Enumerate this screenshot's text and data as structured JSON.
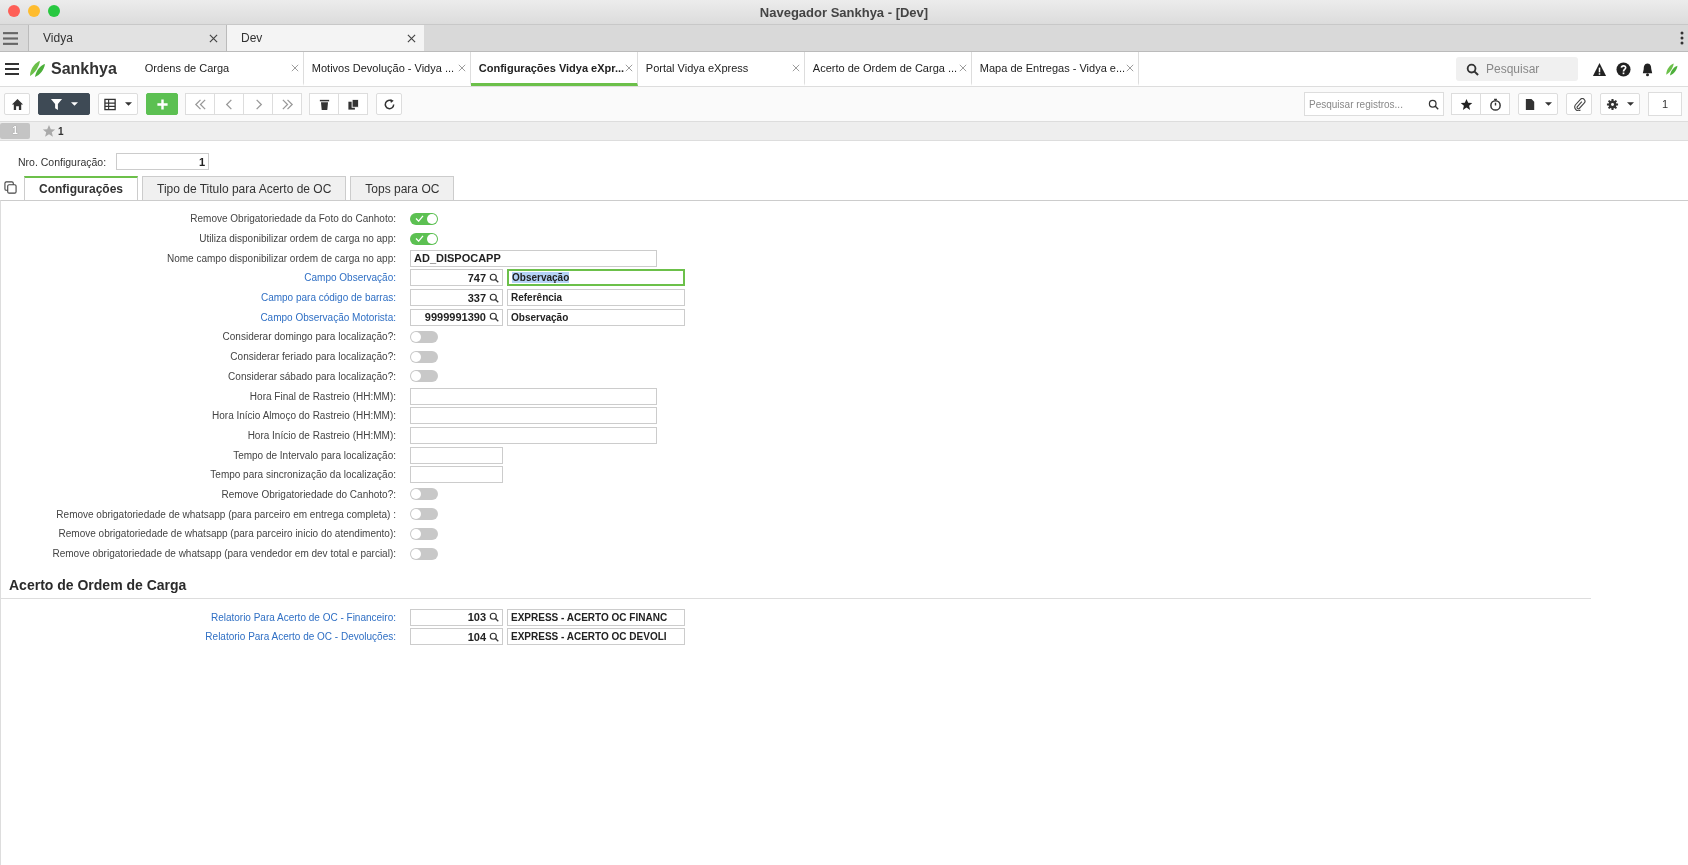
{
  "window": {
    "title": "Navegador Sankhya - [Dev]"
  },
  "browser_tabs": [
    {
      "label": "Vidya",
      "selected": false
    },
    {
      "label": "Dev",
      "selected": true
    }
  ],
  "app": {
    "brand": "Sankhya",
    "search_placeholder": "Pesquisar"
  },
  "app_tabs": [
    {
      "label": "Ordens de Carga",
      "selected": false
    },
    {
      "label": "Motivos Devolução - Vidya ...",
      "selected": false
    },
    {
      "label": "Configurações Vidya eXpr...",
      "selected": true
    },
    {
      "label": "Portal Vidya eXpress",
      "selected": false
    },
    {
      "label": "Acerto de Ordem de Carga ...",
      "selected": false
    },
    {
      "label": "Mapa de Entregas - Vidya e...",
      "selected": false
    }
  ],
  "toolbar": {
    "search_placeholder": "Pesquisar registros...",
    "page": "1"
  },
  "record_bar": {
    "record": "1",
    "favorites": "1"
  },
  "config": {
    "label": "Nro. Configuração:",
    "value": "1"
  },
  "form_tabs": [
    {
      "label": "Configurações",
      "selected": true
    },
    {
      "label": "Tipo de Titulo para Acerto de OC",
      "selected": false
    },
    {
      "label": "Tops para OC",
      "selected": false
    }
  ],
  "fields": [
    {
      "kind": "toggle",
      "label": "Remove Obrigatoriedade da Foto do Canhoto:",
      "on": true
    },
    {
      "kind": "toggle",
      "label": "Utiliza disponibilizar ordem de carga no app:",
      "on": true
    },
    {
      "kind": "text",
      "label": "Nome campo disponibilizar ordem de carga no app:",
      "value": "AD_DISPOCAPP"
    },
    {
      "kind": "lookup",
      "label": "Campo Observação:",
      "code": "747",
      "description": "Observação",
      "focused": true
    },
    {
      "kind": "lookup",
      "label": "Campo para código de barras:",
      "code": "337",
      "description": "Referência",
      "focused": false
    },
    {
      "kind": "lookup",
      "label": "Campo Observação Motorista:",
      "code": "9999991390",
      "description": "Observação",
      "focused": false
    },
    {
      "kind": "toggle",
      "label": "Considerar domingo para localização?:",
      "on": false
    },
    {
      "kind": "toggle",
      "label": "Considerar feriado para localização?:",
      "on": false
    },
    {
      "kind": "toggle",
      "label": "Considerar sábado para localização?:",
      "on": false
    },
    {
      "kind": "text",
      "label": "Hora Final de Rastreio (HH:MM):"
    },
    {
      "kind": "text",
      "label": "Hora Início Almoço do Rastreio (HH:MM):"
    },
    {
      "kind": "text",
      "label": "Hora Início de Rastreio (HH:MM):"
    },
    {
      "kind": "number",
      "label": "Tempo de Intervalo para localização:"
    },
    {
      "kind": "number",
      "label": "Tempo para sincronização da localização:"
    },
    {
      "kind": "toggle",
      "label": "Remove Obrigatoriedade do Canhoto?:",
      "on": false
    },
    {
      "kind": "toggle",
      "label": "Remove obrigatoriedade de whatsapp (para parceiro em entrega completa) :",
      "on": false
    },
    {
      "kind": "toggle",
      "label": "Remove obrigatoriedade de whatsapp (para parceiro inicio do atendimento):",
      "on": false
    },
    {
      "kind": "toggle",
      "label": "Remove obrigatoriedade de whatsapp (para vendedor em dev total e parcial):",
      "on": false
    }
  ],
  "section": {
    "title": "Acerto de Ordem de Carga",
    "fields": [
      {
        "kind": "lookup",
        "label": "Relatorio Para Acerto de OC - Financeiro:",
        "code": "103",
        "description": "EXPRESS - ACERTO OC FINANC",
        "focused": false
      },
      {
        "kind": "lookup",
        "label": "Relatorio Para Acerto de OC - Devoluções:",
        "code": "104",
        "description": "EXPRESS - ACERTO OC DEVOLI",
        "focused": false
      }
    ]
  }
}
